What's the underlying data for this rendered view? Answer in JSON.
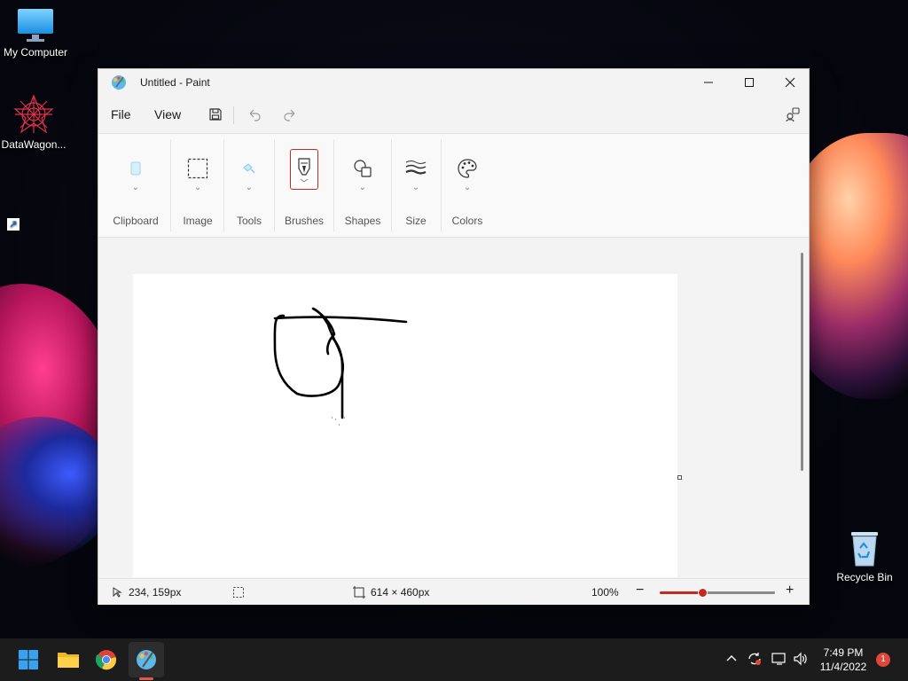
{
  "desktop": {
    "icons": [
      {
        "label": "My Computer",
        "icon": "monitor-icon"
      },
      {
        "label": "DataWagon...",
        "icon": "datawagon-logo-icon"
      },
      {
        "label": "Recycle Bin",
        "icon": "recycle-bin-icon"
      }
    ]
  },
  "window": {
    "title": "Untitled - Paint",
    "controls": {
      "minimize": "minimize-icon",
      "maximize": "maximize-icon",
      "close": "close-icon"
    }
  },
  "menubar": {
    "file": "File",
    "view": "View",
    "tools": [
      "save-icon",
      "undo-icon",
      "redo-icon",
      "share-icon"
    ]
  },
  "ribbon": {
    "groups": [
      {
        "label": "Clipboard",
        "icon": "clipboard-icon"
      },
      {
        "label": "Image",
        "icon": "select-icon"
      },
      {
        "label": "Tools",
        "icon": "tools-icon"
      },
      {
        "label": "Brushes",
        "icon": "brush-icon",
        "selected": true
      },
      {
        "label": "Shapes",
        "icon": "shapes-icon"
      },
      {
        "label": "Size",
        "icon": "stroke-size-icon"
      },
      {
        "label": "Colors",
        "icon": "palette-icon"
      }
    ]
  },
  "statusbar": {
    "cursor_position": "234, 159px",
    "canvas_size": "614 × 460px",
    "zoom": "100%",
    "zoom_slider_fraction": 0.38
  },
  "taskbar": {
    "apps": [
      "start-icon",
      "file-explorer-icon",
      "chrome-icon",
      "paint-icon"
    ],
    "time": "7:49 PM",
    "date": "11/4/2022",
    "notifications": "1"
  },
  "colors": {
    "accent": "#c42b1c",
    "taskbar": "#1c1c1c",
    "window_bg": "#f3f3f3"
  }
}
